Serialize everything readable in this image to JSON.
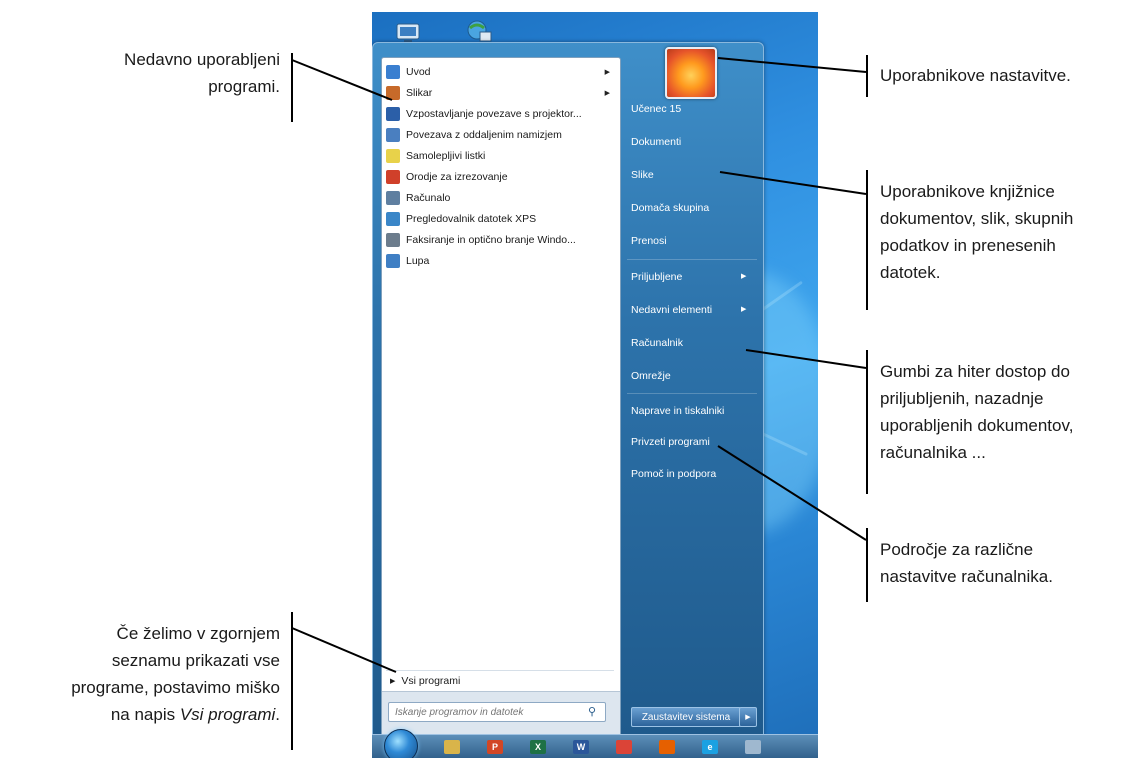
{
  "start_menu": {
    "programs": [
      {
        "label": "Uvod",
        "submenu": true,
        "icon": "uvod-icon",
        "color": "#3a7fd0"
      },
      {
        "label": "Slikar",
        "submenu": true,
        "icon": "paint-icon",
        "color": "#c76a2a"
      },
      {
        "label": "Vzpostavljanje povezave s projektor...",
        "submenu": false,
        "icon": "projector-icon",
        "color": "#2b5fa8"
      },
      {
        "label": "Povezava z oddaljenim namizjem",
        "submenu": false,
        "icon": "remote-desktop-icon",
        "color": "#4a7fc0"
      },
      {
        "label": "Samolepljivi listki",
        "submenu": false,
        "icon": "sticky-notes-icon",
        "color": "#e8d24a"
      },
      {
        "label": "Orodje za izrezovanje",
        "submenu": false,
        "icon": "snipping-tool-icon",
        "color": "#d0402a"
      },
      {
        "label": "Računalo",
        "submenu": false,
        "icon": "calculator-icon",
        "color": "#5f7fa0"
      },
      {
        "label": "Pregledovalnik datotek XPS",
        "submenu": false,
        "icon": "xps-viewer-icon",
        "color": "#3a86c8"
      },
      {
        "label": "Faksiranje in optično branje Windo...",
        "submenu": false,
        "icon": "fax-scan-icon",
        "color": "#6c7c8c"
      },
      {
        "label": "Lupa",
        "submenu": false,
        "icon": "magnifier-icon",
        "color": "#3f7fc4"
      }
    ],
    "all_programs": "Vsi programi",
    "search_placeholder": "Iskanje programov in datotek",
    "right_items": [
      {
        "label": "Učenec 15",
        "submenu": false
      },
      {
        "label": "Dokumenti",
        "submenu": false
      },
      {
        "label": "Slike",
        "submenu": false
      },
      {
        "label": "Domača skupina",
        "submenu": false
      },
      {
        "label": "Prenosi",
        "submenu": false
      },
      {
        "label": "Priljubljene",
        "submenu": true
      },
      {
        "label": "Nedavni elementi",
        "submenu": true
      },
      {
        "label": "Računalnik",
        "submenu": false
      },
      {
        "label": "Omrežje",
        "submenu": false
      },
      {
        "label": "Naprave in tiskalniki",
        "submenu": false
      },
      {
        "label": "Privzeti programi",
        "submenu": false
      },
      {
        "label": "Pomoč in podpora",
        "submenu": false
      }
    ],
    "shutdown": "Zaustavitev sistema"
  },
  "taskbar": {
    "apps": [
      {
        "icon": "explorer-icon",
        "glyph": "",
        "color": "#d9b44a"
      },
      {
        "icon": "powerpoint-icon",
        "glyph": "P",
        "color": "#d24726"
      },
      {
        "icon": "excel-icon",
        "glyph": "X",
        "color": "#1e7145"
      },
      {
        "icon": "word-icon",
        "glyph": "W",
        "color": "#2b579a"
      },
      {
        "icon": "chrome-icon",
        "glyph": "",
        "color": "#db4437"
      },
      {
        "icon": "firefox-icon",
        "glyph": "",
        "color": "#e66000"
      },
      {
        "icon": "ie-icon",
        "glyph": "e",
        "color": "#1ba1e2"
      },
      {
        "icon": "settings-icon",
        "glyph": "",
        "color": "#9fb8cf"
      }
    ]
  },
  "annotations": {
    "recent_programs": [
      "Nedavno uporabljeni",
      "programi."
    ],
    "user_settings": "Uporabnikove nastavitve.",
    "libraries": [
      "Uporabnikove knjižnice",
      "dokumentov, slik, skupnih",
      "podatkov in prenesenih",
      "datotek."
    ],
    "quick_buttons": [
      "Gumbi za hiter dostop do",
      "priljubljenih, nazadnje",
      "uporabljenih dokumentov,",
      "računalnika ..."
    ],
    "settings_area": [
      "Področje za različne",
      "nastavitve računalnika."
    ],
    "all_programs_hint": [
      "Če želimo v zgornjem",
      "seznamu prikazati vse",
      "programe, postavimo miško",
      "na napis ",
      "Vsi programi",
      "."
    ]
  }
}
